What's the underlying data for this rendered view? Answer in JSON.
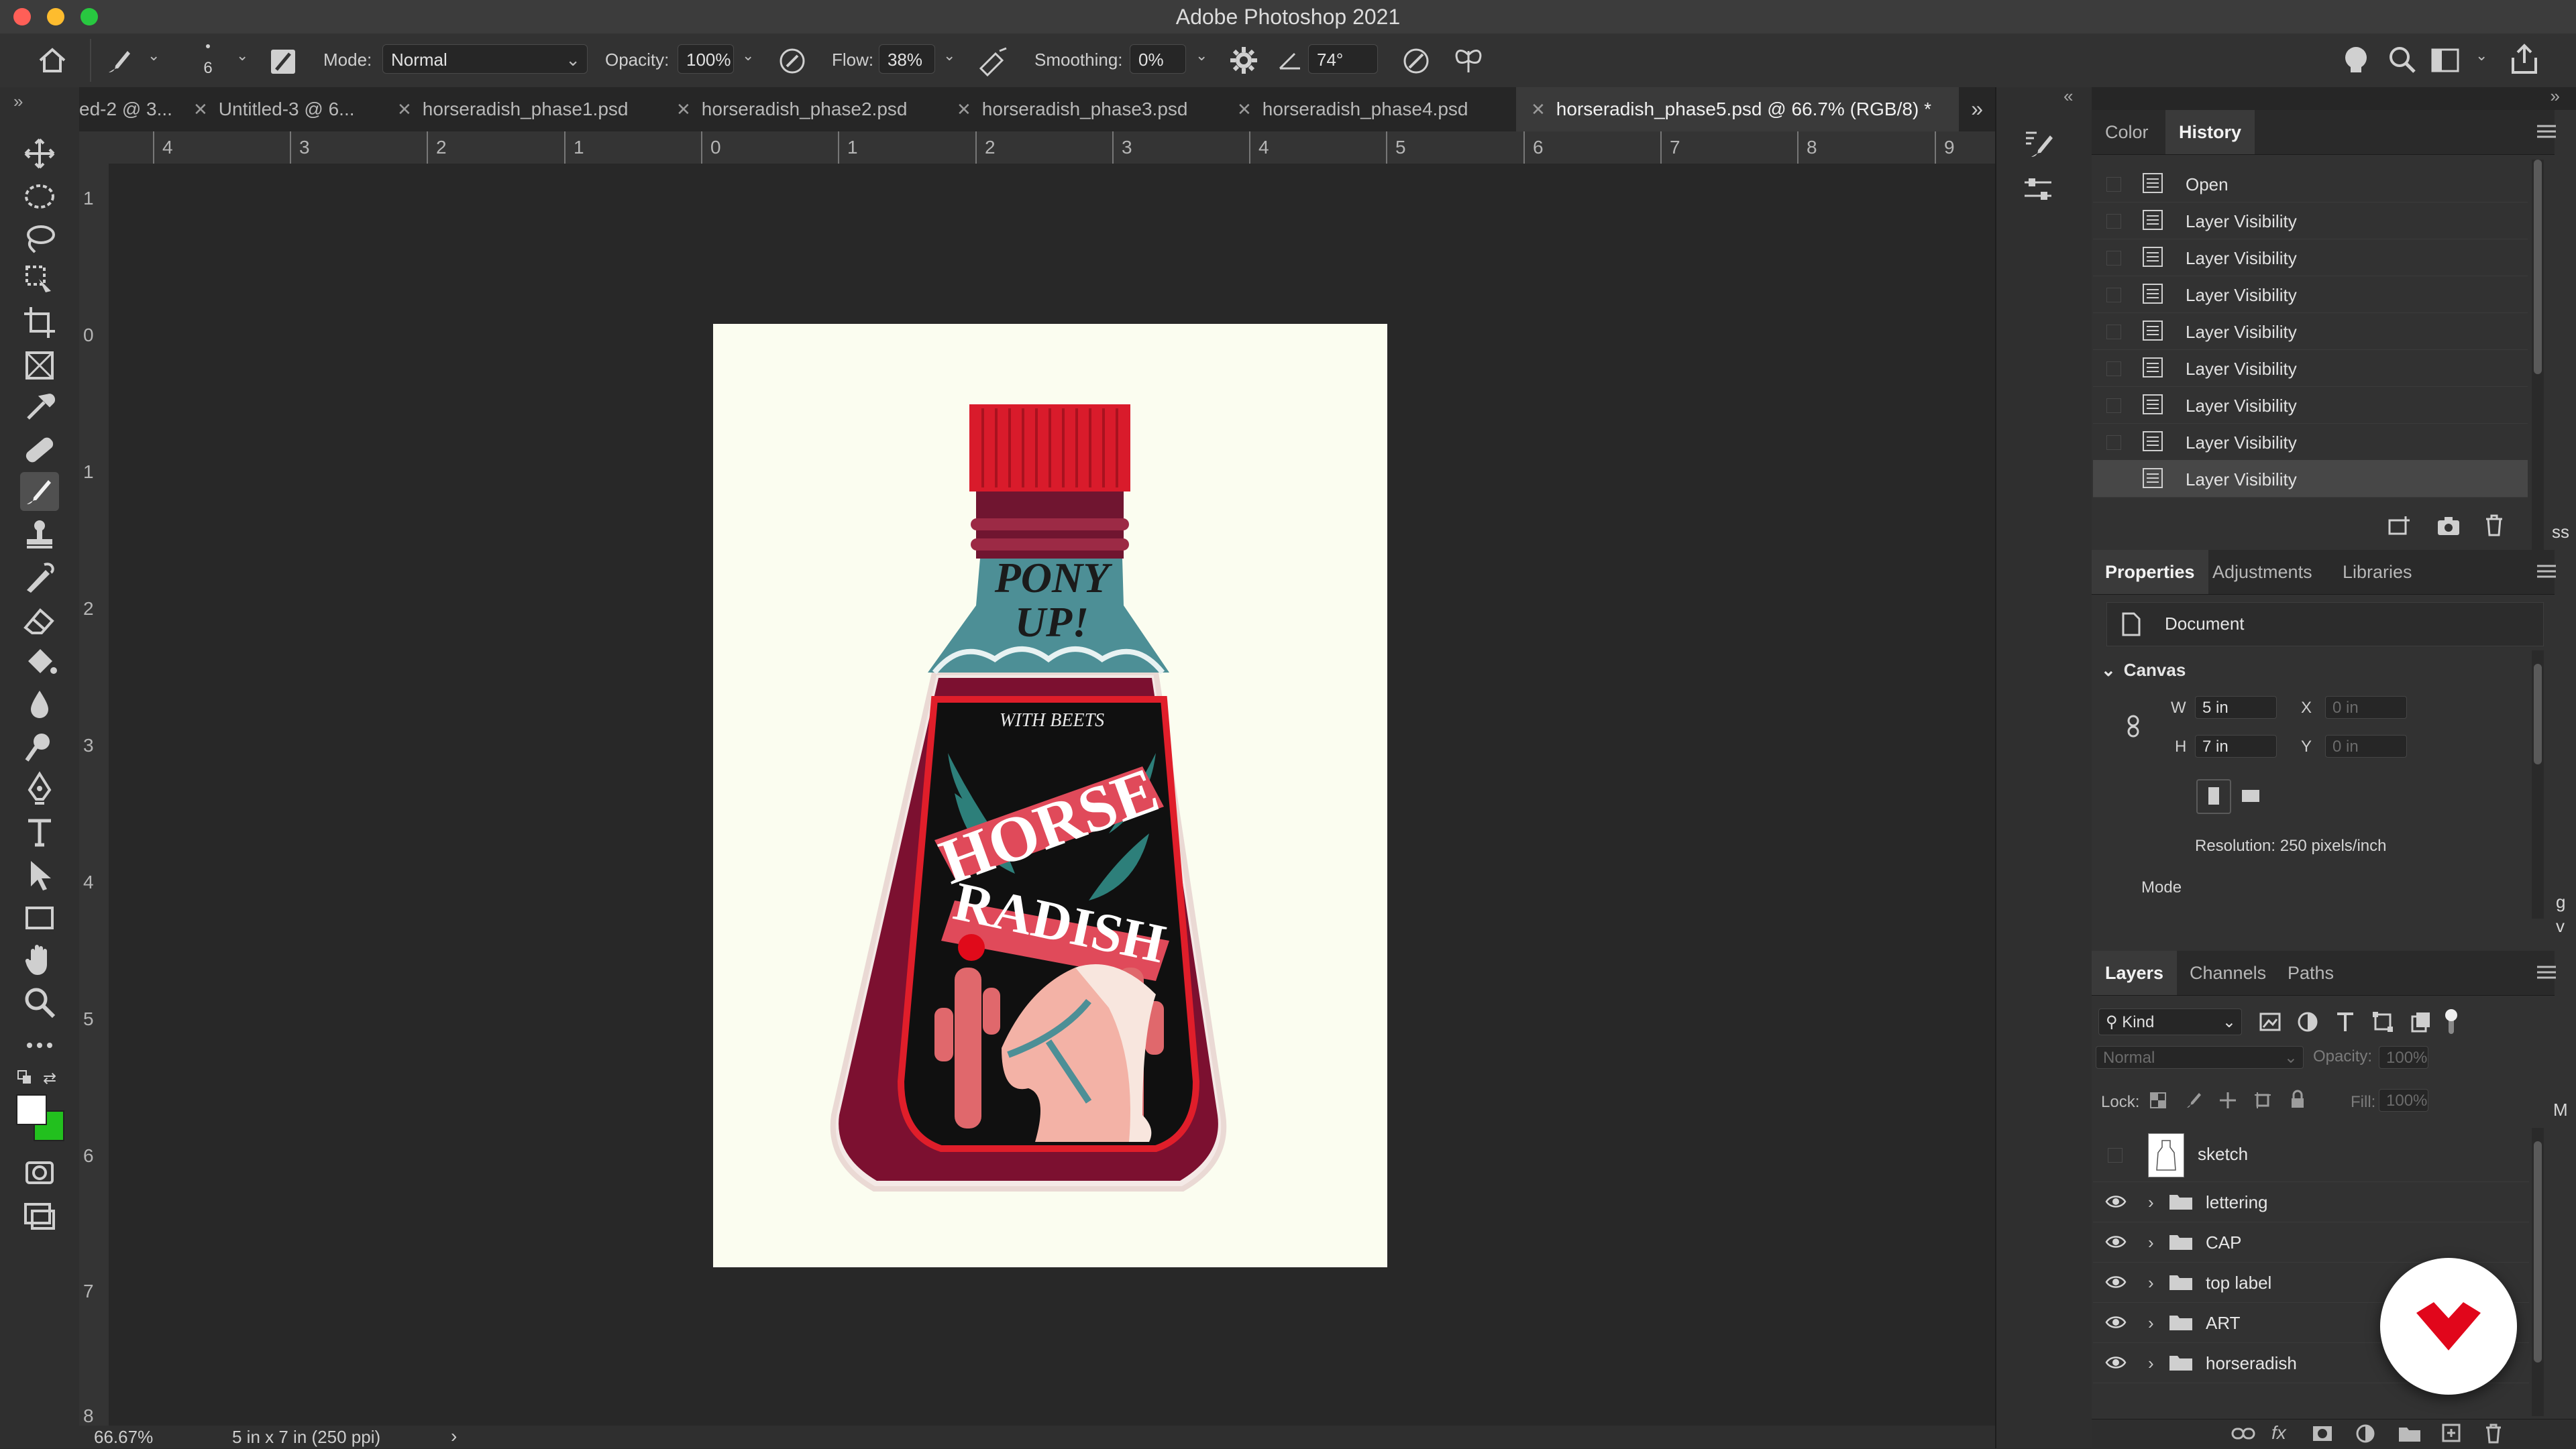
{
  "window": {
    "title": "Adobe Photoshop 2021"
  },
  "options_bar": {
    "brush_size": "6",
    "mode_label": "Mode:",
    "mode_value": "Normal",
    "opacity_label": "Opacity:",
    "opacity_value": "100%",
    "flow_label": "Flow:",
    "flow_value": "38%",
    "smoothing_label": "Smoothing:",
    "smoothing_value": "0%",
    "angle_value": "74°"
  },
  "tabs": [
    {
      "label": "ed-2 @ 3...",
      "active": false
    },
    {
      "label": "Untitled-3 @ 6...",
      "active": false
    },
    {
      "label": "horseradish_phase1.psd",
      "active": false
    },
    {
      "label": "horseradish_phase2.psd",
      "active": false
    },
    {
      "label": "horseradish_phase3.psd",
      "active": false
    },
    {
      "label": "horseradish_phase4.psd",
      "active": false
    },
    {
      "label": "horseradish_phase5.psd @ 66.7% (RGB/8) *",
      "active": true
    }
  ],
  "rulers": {
    "horizontal": [
      "4",
      "3",
      "2",
      "1",
      "0",
      "1",
      "2",
      "3",
      "4",
      "5",
      "6",
      "7",
      "8",
      "9"
    ],
    "vertical": [
      "1",
      "0",
      "1",
      "2",
      "3",
      "4",
      "5",
      "6",
      "7",
      "8"
    ]
  },
  "artwork": {
    "neck_text_1": "PONY",
    "neck_text_2": "UP!",
    "small_text": "WITH BEETS",
    "banner_1": "HORSE",
    "banner_2": "RADISH"
  },
  "status": {
    "zoom": "66.67%",
    "doc_info": "5 in x 7 in (250 ppi)",
    "arrow": "›"
  },
  "history_panel": {
    "tabs": [
      "Color",
      "History"
    ],
    "active_tab": "History",
    "items": [
      "Open",
      "Layer Visibility",
      "Layer Visibility",
      "Layer Visibility",
      "Layer Visibility",
      "Layer Visibility",
      "Layer Visibility",
      "Layer Visibility",
      "Layer Visibility"
    ]
  },
  "properties_panel": {
    "tabs": [
      "Properties",
      "Adjustments",
      "Libraries"
    ],
    "active_tab": "Properties",
    "doc_label": "Document",
    "section": "Canvas",
    "w_label": "W",
    "w_value": "5 in",
    "h_label": "H",
    "h_value": "7 in",
    "x_label": "X",
    "x_value": "0 in",
    "y_label": "Y",
    "y_value": "0 in",
    "resolution": "Resolution: 250 pixels/inch",
    "mode_label": "Mode"
  },
  "layers_panel": {
    "tabs": [
      "Layers",
      "Channels",
      "Paths"
    ],
    "active_tab": "Layers",
    "filter_label": "Kind",
    "blend_mode": "Normal",
    "opacity_label": "Opacity:",
    "opacity_value": "100%",
    "lock_label": "Lock:",
    "fill_label": "Fill:",
    "fill_value": "100%",
    "layers": [
      {
        "name": "sketch",
        "visible": false,
        "type": "layer"
      },
      {
        "name": "lettering",
        "visible": true,
        "type": "group"
      },
      {
        "name": "CAP",
        "visible": true,
        "type": "group"
      },
      {
        "name": "top label",
        "visible": true,
        "type": "group"
      },
      {
        "name": "ART",
        "visible": true,
        "type": "group"
      },
      {
        "name": "horseradish",
        "visible": true,
        "type": "group"
      }
    ]
  },
  "edge_overflow": {
    "a": "ss",
    "b": "g",
    "c": "v",
    "d": "M"
  },
  "colors": {
    "foreground": "#ffffff",
    "background": "#22c01e",
    "bottle_red": "#7c1030",
    "cap_red": "#d91b2b",
    "neck_teal": "#4d8f96",
    "badge_red": "#e1061b"
  }
}
